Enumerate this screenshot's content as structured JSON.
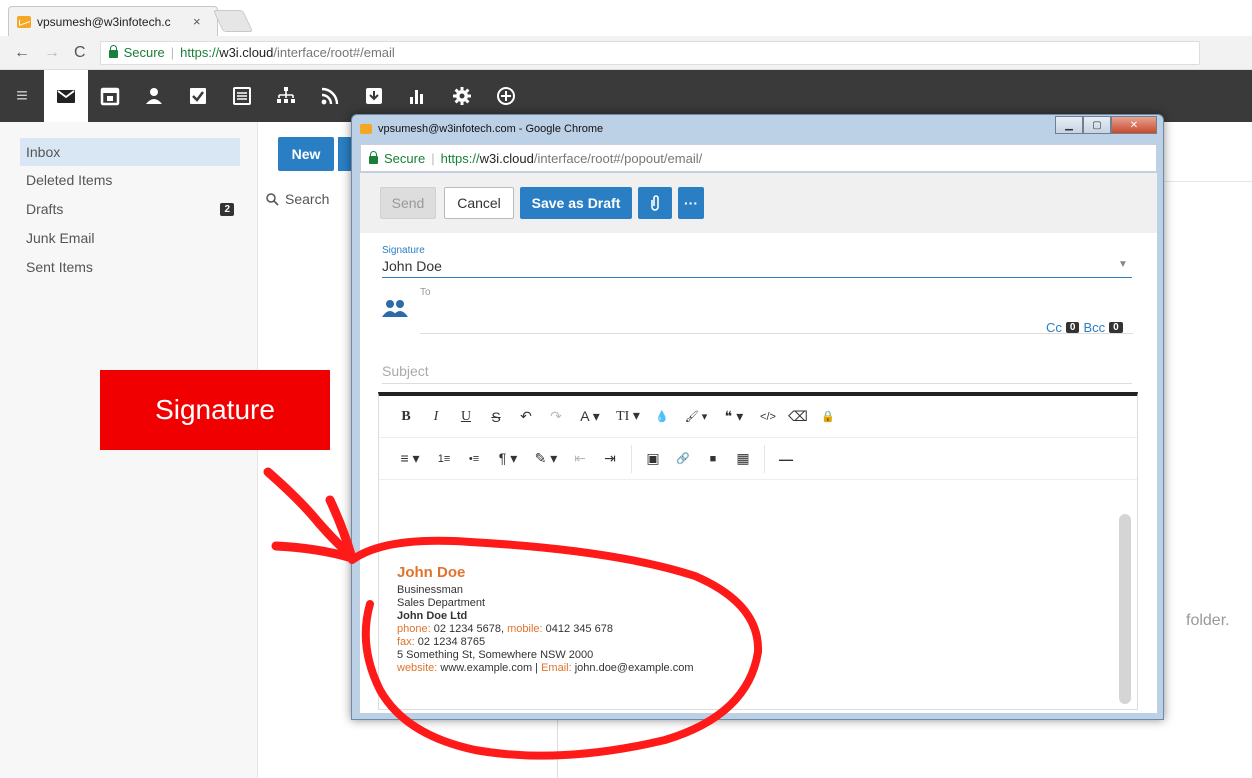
{
  "browser": {
    "tab_title": "vpsumesh@w3infotech.c",
    "tab_close": "×",
    "secure_label": "Secure",
    "url_scheme": "https://",
    "url_host": "w3i.cloud",
    "url_path": "/interface/root#/email"
  },
  "apptoolbar": {
    "icons": [
      "menu-icon",
      "mail-icon",
      "calendar-icon",
      "contacts-icon",
      "tasks-icon",
      "notes-icon",
      "org-chart-icon",
      "rss-icon",
      "download-icon",
      "stats-icon",
      "settings-icon",
      "add-icon"
    ]
  },
  "folders": [
    {
      "label": "Inbox",
      "selected": true
    },
    {
      "label": "Deleted Items"
    },
    {
      "label": "Drafts",
      "count": "2"
    },
    {
      "label": "Junk Email"
    },
    {
      "label": "Sent Items"
    }
  ],
  "list": {
    "new_label": "New",
    "search_placeholder": "Search"
  },
  "main": {
    "empty_text": "folder."
  },
  "popup": {
    "window_title": "vpsumesh@w3infotech.com - Google Chrome",
    "secure_label": "Secure",
    "url_scheme": "https://",
    "url_host": "w3i.cloud",
    "url_path": "/interface/root#/popout/email/",
    "send_label": "Send",
    "cancel_label": "Cancel",
    "draft_label": "Save as Draft",
    "more_label": "···",
    "signature_label": "Signature",
    "signature_value": "John Doe",
    "to_label": "To",
    "cc_label": "Cc",
    "cc_count": "0",
    "bcc_label": "Bcc",
    "bcc_count": "0",
    "subject_placeholder": "Subject",
    "toolbar_row1": [
      "B",
      "I",
      "U",
      "S",
      "↶",
      "↷",
      "A ▾",
      "TI ▾",
      "💧",
      "🖌 ▾",
      "❝ ▾",
      "</>",
      "⌫",
      "🔒"
    ],
    "toolbar_row2": [
      "≡ ▾",
      "1≡",
      "•≡",
      "¶ ▾",
      "✎ ▾",
      "⇤",
      "⇥",
      "▣",
      "🔗",
      "■",
      "▦",
      "—"
    ]
  },
  "signature": {
    "name": "John Doe",
    "title": "Businessman",
    "department": "Sales Department",
    "company": "John Doe Ltd",
    "phone_label": "phone:",
    "phone": "02 1234 5678,",
    "mobile_label": "mobile:",
    "mobile": "0412 345 678",
    "fax_label": "fax:",
    "fax": "02 1234 8765",
    "address": "5 Something St, Somewhere NSW 2000",
    "website_label": "website:",
    "website": "www.example.com |",
    "email_label": "Email:",
    "email": "john.doe@example.com"
  },
  "annotation": {
    "label": "Signature",
    "color": "#f00000"
  }
}
